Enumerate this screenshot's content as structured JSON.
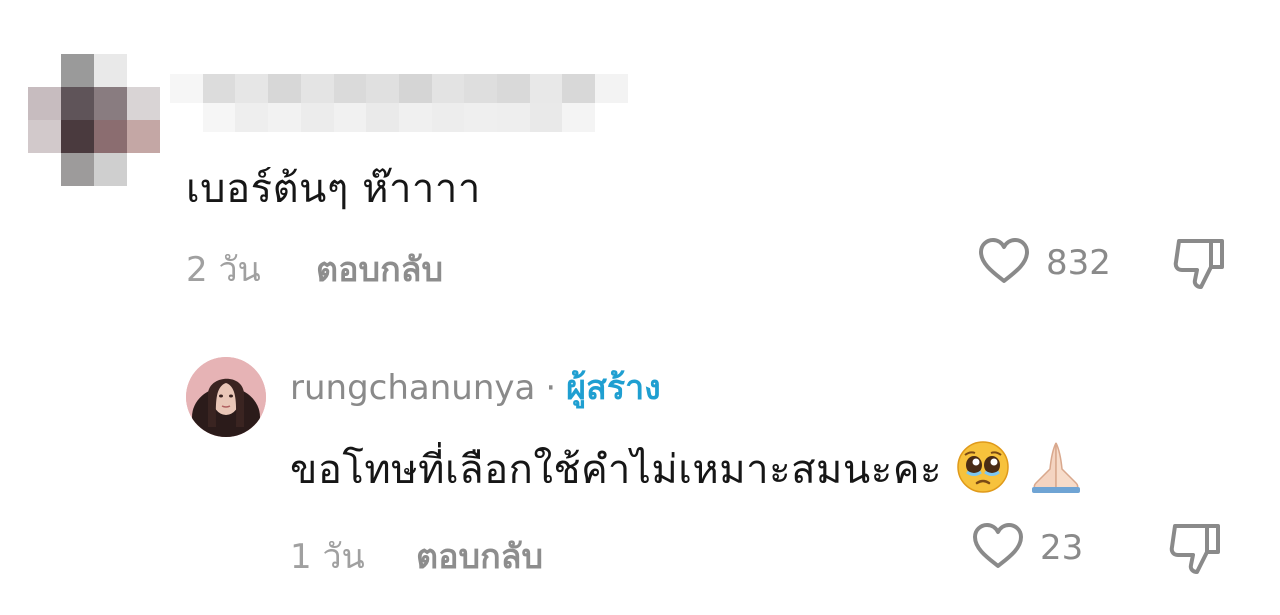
{
  "comments": [
    {
      "username": "",
      "text": "เบอร์ต้นๆ ห๊าาาา",
      "time": "2 วัน",
      "reply_label": "ตอบกลับ",
      "likes": "832",
      "avatar_pixels": [
        "#ffffff",
        "#9a9a9a",
        "#e9e9e9",
        "#ffffff",
        "#c7bcbf",
        "#5f5459",
        "#897c80",
        "#d9d4d5",
        "#d2c9cb",
        "#4a3a3e",
        "#8b6d70",
        "#c4a7a5",
        "#ffffff",
        "#9d9b9b",
        "#cfcfcf",
        "#ffffff"
      ],
      "name_blur_pixels": [
        "#f6f6f6",
        "#dcdcdc",
        "#e6e6e6",
        "#d7d7d7",
        "#e4e4e4",
        "#dadada",
        "#e0e0e0",
        "#d5d5d5",
        "#e3e3e3",
        "#dedede",
        "#d9d9d9",
        "#e8e8e8",
        "#d8d8d8",
        "#f3f3f3",
        "#ffffff",
        "#f6f6f6",
        "#eeeeee",
        "#f2f2f2",
        "#ececec",
        "#f1f1f1",
        "#eaeaea",
        "#f0f0f0",
        "#ededed",
        "#efefef",
        "#eeeeee",
        "#e9e9e9",
        "#f4f4f4",
        "#ffffff"
      ]
    },
    {
      "username": "rungchanunya",
      "separator": "·",
      "badge": "ผู้สร้าง",
      "text": "ขอโทษที่เลือกใช้คำไม่เหมาะสมนะคะ",
      "time": "1 วัน",
      "reply_label": "ตอบกลับ",
      "likes": "23",
      "emojis": [
        "pleading-face-icon",
        "folded-hands-icon"
      ]
    }
  ],
  "colors": {
    "creator_badge": "#1f9fd1",
    "meta_text": "#a0a0a0",
    "icon_stroke": "#8a8a8a"
  }
}
